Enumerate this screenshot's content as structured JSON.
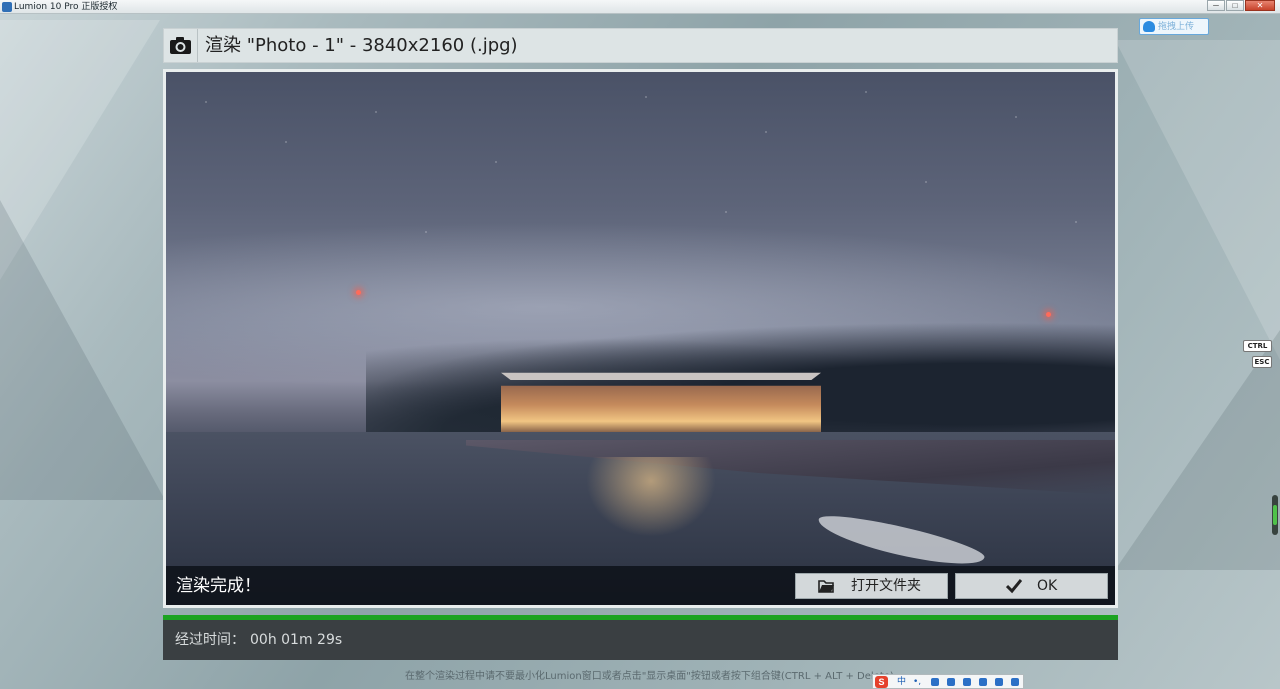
{
  "window": {
    "title": "Lumion 10 Pro 正版授权",
    "min_label": "─",
    "max_label": "□",
    "close_label": "✕"
  },
  "cloud_widget": {
    "label": "拖拽上传",
    "icon": "cloud-icon"
  },
  "dialog": {
    "camera_icon": "camera-icon",
    "title": "渲染 \"Photo - 1\" - 3840x2160 (.jpg)"
  },
  "render": {
    "status": "渲染完成！",
    "open_folder_label": "打开文件夹",
    "ok_label": "OK",
    "progress_percent": 100
  },
  "elapsed": {
    "label": "经过时间：",
    "value": "00h 01m 29s"
  },
  "bottom_note": "在整个渲染过程中请不要最小化Lumion窗口或者点击\"显示桌面\"按钮或者按下组合键(CTRL + ALT + Delete)",
  "ime": {
    "logo": "S",
    "mode": "中",
    "punct": "•,"
  },
  "keys": {
    "ctrl": "CTRL",
    "esc": "ESC"
  },
  "colors": {
    "progress": "#1ca321",
    "status_bar": "#0a0e14",
    "button_bg": "#d3d8da"
  }
}
